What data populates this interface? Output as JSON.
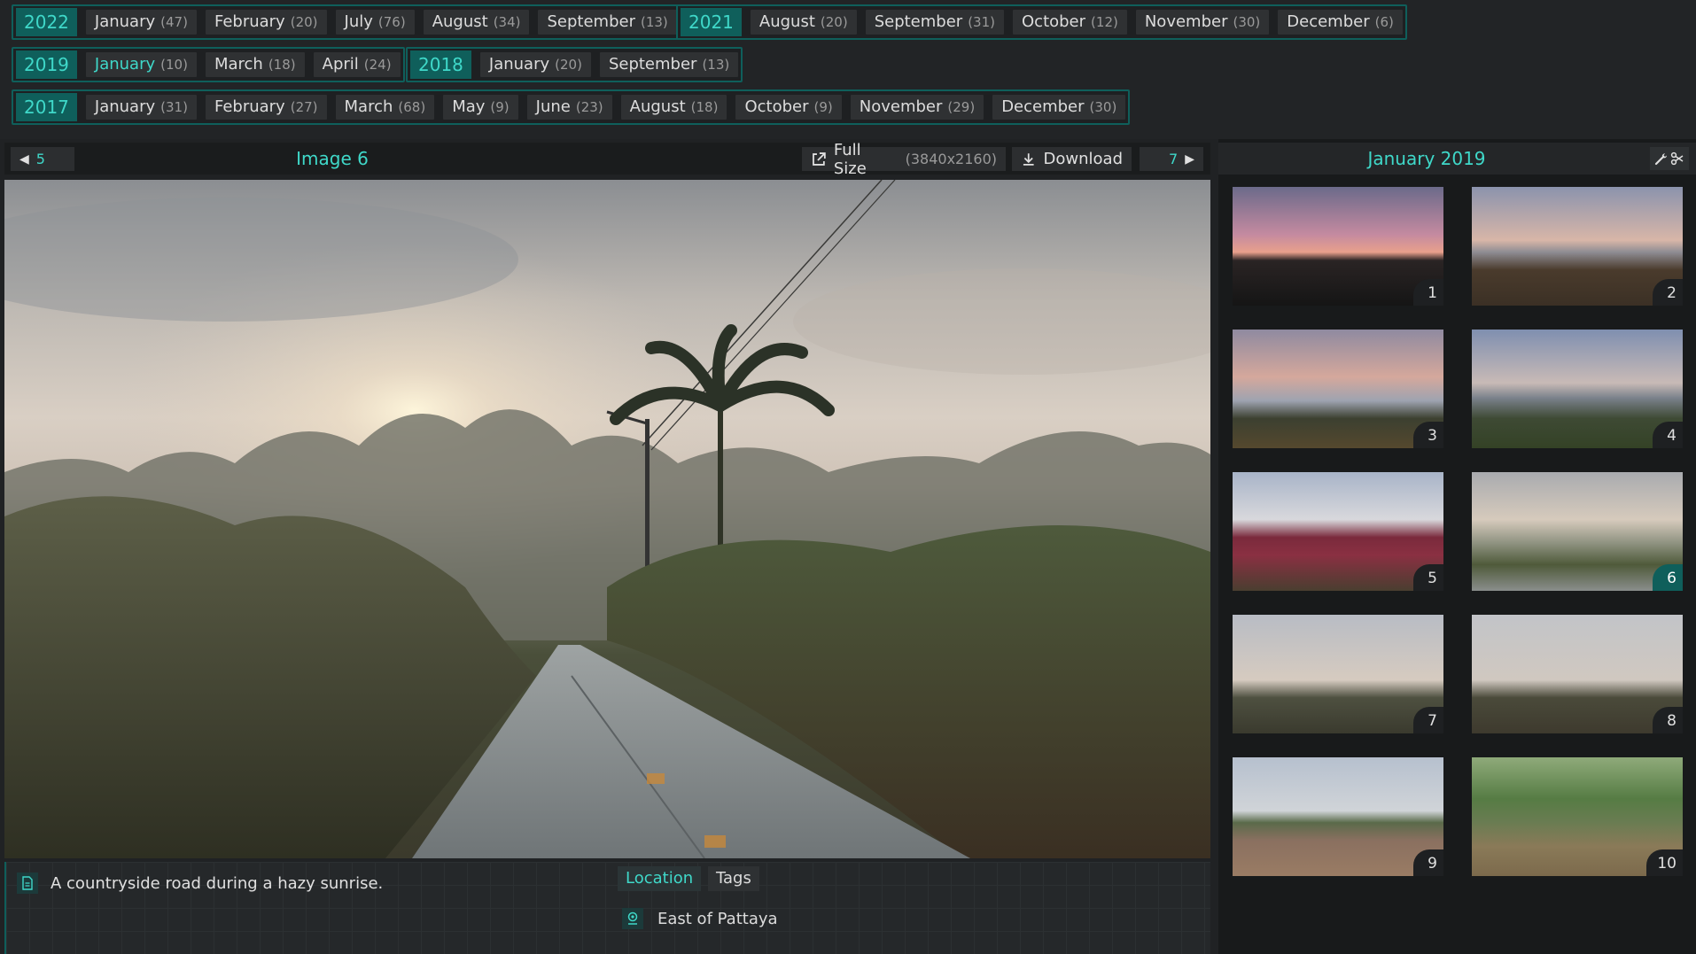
{
  "years": [
    {
      "year": "2022",
      "months": [
        {
          "name": "January",
          "count": "(47)"
        },
        {
          "name": "February",
          "count": "(20)"
        },
        {
          "name": "July",
          "count": "(76)"
        },
        {
          "name": "August",
          "count": "(34)"
        },
        {
          "name": "September",
          "count": "(13)"
        }
      ]
    },
    {
      "year": "2021",
      "months": [
        {
          "name": "August",
          "count": "(20)"
        },
        {
          "name": "September",
          "count": "(31)"
        },
        {
          "name": "October",
          "count": "(12)"
        },
        {
          "name": "November",
          "count": "(30)"
        },
        {
          "name": "December",
          "count": "(6)"
        }
      ]
    },
    {
      "year": "2019",
      "months": [
        {
          "name": "January",
          "count": "(10)",
          "active": true
        },
        {
          "name": "March",
          "count": "(18)"
        },
        {
          "name": "April",
          "count": "(24)"
        }
      ]
    },
    {
      "year": "2018",
      "months": [
        {
          "name": "January",
          "count": "(20)"
        },
        {
          "name": "September",
          "count": "(13)"
        }
      ]
    },
    {
      "year": "2017",
      "months": [
        {
          "name": "January",
          "count": "(31)"
        },
        {
          "name": "February",
          "count": "(27)"
        },
        {
          "name": "March",
          "count": "(68)"
        },
        {
          "name": "May",
          "count": "(9)"
        },
        {
          "name": "June",
          "count": "(23)"
        },
        {
          "name": "August",
          "count": "(18)"
        },
        {
          "name": "October",
          "count": "(9)"
        },
        {
          "name": "November",
          "count": "(29)"
        },
        {
          "name": "December",
          "count": "(30)"
        }
      ]
    }
  ],
  "viewer": {
    "prev_number": "5",
    "title": "Image 6",
    "full_size_label": "Full Size",
    "full_size_dims": "(3840x2160)",
    "download_label": "Download",
    "next_number": "7"
  },
  "info": {
    "caption": "A countryside road during a hazy sunrise.",
    "tabs": [
      "Location",
      "Tags"
    ],
    "location": "East of Pattaya"
  },
  "sidebar": {
    "title": "January 2019",
    "thumbnails": [
      "1",
      "2",
      "3",
      "4",
      "5",
      "6",
      "7",
      "8",
      "9",
      "10"
    ],
    "current": "6"
  },
  "colors": {
    "accent": "#3fd8c9",
    "accent_dark": "#0f5f5b",
    "background": "#202224"
  }
}
